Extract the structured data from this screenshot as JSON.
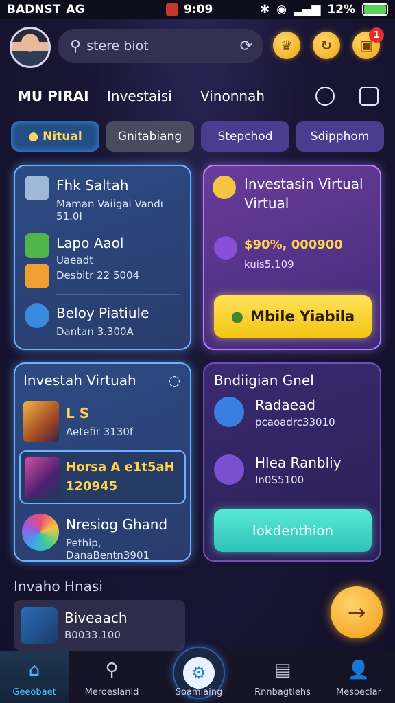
{
  "status_bar": {
    "carrier": "BADNST",
    "network": "AG",
    "time": "9:09",
    "battery_percent": "12%"
  },
  "header": {
    "search_placeholder": "stere biot",
    "notification_count": "1"
  },
  "tabs": [
    {
      "label": "MU PIRAI",
      "active": true
    },
    {
      "label": "Investaisi",
      "active": false
    },
    {
      "label": "Vinonnah",
      "active": false
    }
  ],
  "chips": [
    {
      "label": "Nitual",
      "active": true
    },
    {
      "label": "Gnitabiang",
      "active": false
    },
    {
      "label": "Stepchod",
      "active": false
    },
    {
      "label": "Sdipphom",
      "active": false
    }
  ],
  "card_left_top": {
    "items": [
      {
        "title": "Fhk Saltah",
        "subtitle": "Maman Vaiigai Vandı 51.0I"
      },
      {
        "title": "Lapo Aaol",
        "subtitle": "Uaeadt",
        "subtitle2": "Desbitr 22 5004"
      },
      {
        "title": "Beloy Piatiule",
        "subtitle": "Dantan 3.300A"
      }
    ]
  },
  "card_right_top": {
    "title": "Investasin Virtual Virtual",
    "value": "$90%, 000900",
    "sub": "kuis5.109",
    "button": "Mbile Yiabila"
  },
  "card_left_bottom": {
    "title": "Investah Virtuah",
    "items": [
      {
        "title": "L S",
        "subtitle": "Aetefir 3130f"
      },
      {
        "title": "Horsa A e1t5aH",
        "subtitle": "120945"
      },
      {
        "title": "Nresiog Ghand",
        "subtitle": "Pethip, DanaBentn3901"
      }
    ]
  },
  "card_right_bottom": {
    "title": "Bndiigian Gnel",
    "items": [
      {
        "title": "Radaead",
        "subtitle": "pcaoadrc33010"
      },
      {
        "title": "Hlea Ranbliy",
        "subtitle": "In0S5100"
      }
    ],
    "button": "Iokdenthion"
  },
  "section": {
    "title": "Invaho Hnasi"
  },
  "bottom_card": {
    "title": "Biveaach",
    "subtitle": "B0033.100"
  },
  "nav": [
    {
      "label": "Geeobaet",
      "icon": "home-icon",
      "active": true
    },
    {
      "label": "Meroeslanld",
      "icon": "search-icon",
      "active": false
    },
    {
      "label": "Soamiaing",
      "icon": "gear-icon",
      "active": false
    },
    {
      "label": "Rnnbagtlehs",
      "icon": "news-icon",
      "active": false
    },
    {
      "label": "Mesoeclar",
      "icon": "user-icon",
      "active": false
    }
  ],
  "colors": {
    "accent_yellow": "#f3c513",
    "accent_blue": "#3fc0f4",
    "accent_teal": "#2fc2b9",
    "accent_purple": "#7b4fd0"
  }
}
